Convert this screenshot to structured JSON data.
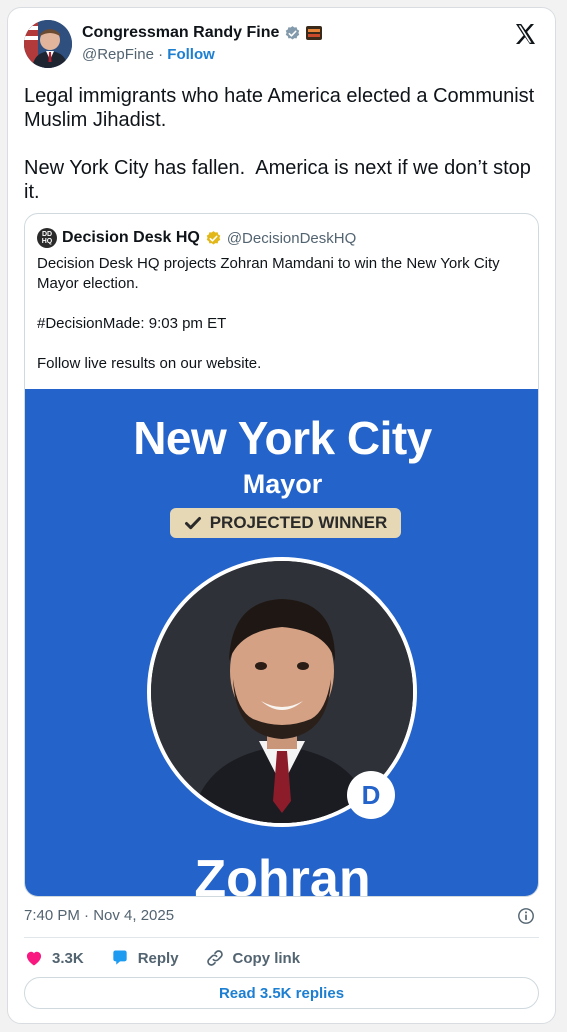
{
  "author": {
    "name": "Congressman Randy Fine",
    "handle": "@RepFine",
    "separator": "·",
    "follow_label": "Follow",
    "verified_badge": "gray-check-icon",
    "affiliate_badge": "congress-seal-icon"
  },
  "platform_logo": "x-logo-icon",
  "tweet": {
    "paragraphs": [
      "Legal immigrants who hate America elected a Communist Muslim Jihadist.",
      "New York City has fallen.  America is next if we don’t stop it."
    ]
  },
  "quote": {
    "avatar_text": "DD HQ",
    "name": "Decision Desk HQ",
    "handle": "@DecisionDeskHQ",
    "verified_badge": "gold-check-icon",
    "paragraphs": [
      "Decision Desk HQ projects Zohran Mamdani to win the New York City Mayor election.",
      "#DecisionMade: 9:03 pm ET",
      "Follow live results on our website."
    ],
    "media": {
      "title": "New York City",
      "subtitle": "Mayor",
      "badge": "PROJECTED WINNER",
      "party_letter": "D",
      "candidate_name": "Zohran",
      "background_color": "#2463c9"
    }
  },
  "timestamp": "7:40 PM · Nov 4, 2025",
  "actions": {
    "likes": "3.3K",
    "reply_label": "Reply",
    "copy_label": "Copy link"
  },
  "read_replies_label": "Read 3.5K replies",
  "colors": {
    "accent": "#1d7fd1",
    "like": "#f91880",
    "muted": "#536471"
  }
}
